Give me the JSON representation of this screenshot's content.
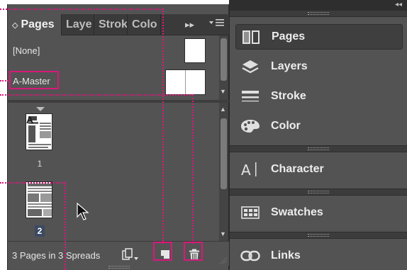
{
  "pages_panel": {
    "tabs": [
      {
        "label": "Pages",
        "active": true
      },
      {
        "label": "Laye",
        "active": false
      },
      {
        "label": "Strok",
        "active": false
      },
      {
        "label": "Colo",
        "active": false
      }
    ],
    "menu_glyph": "▸▸",
    "masters": [
      {
        "label": "[None]"
      },
      {
        "label": "A-Master"
      }
    ],
    "pages": [
      {
        "number": "1",
        "master_prefix": "A",
        "selected": false
      },
      {
        "number": "2",
        "master_prefix": "",
        "selected": true
      }
    ],
    "status": "3 Pages in 3 Spreads",
    "buttons": [
      "edit-page-size-icon",
      "new-page-icon",
      "delete-page-icon"
    ]
  },
  "dock": {
    "collapse_glyph": "◂◂",
    "items": [
      {
        "label": "Pages",
        "icon": "pages-icon",
        "active": true
      },
      {
        "label": "Layers",
        "icon": "layers-icon",
        "active": false
      },
      {
        "label": "Stroke",
        "icon": "stroke-icon",
        "active": false
      },
      {
        "label": "Color",
        "icon": "color-icon",
        "active": false
      },
      {
        "label": "Character",
        "icon": "character-icon",
        "active": false
      },
      {
        "label": "Swatches",
        "icon": "swatches-icon",
        "active": false
      },
      {
        "label": "Links",
        "icon": "links-icon",
        "active": false
      }
    ]
  },
  "colors": {
    "panel_bg": "#535353",
    "callout": "#d8197a",
    "selection": "#3a4a63"
  }
}
